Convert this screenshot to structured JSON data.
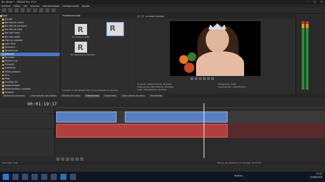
{
  "window": {
    "title": "Sin titulo * - VEGAS Pro 15.0"
  },
  "menu": [
    "Archivo",
    "Editar",
    "Ver",
    "Insertar",
    "Herramientas",
    "Configuración",
    "Ayuda"
  ],
  "explorer": {
    "root": "Todo",
    "items": [
      "Ajustar",
      "Barrido de cierre",
      "Barrido de persiana",
      "Barrido de reloj",
      "Barrido lineal",
      "Barrido radial",
      "Caja de pépelet",
      "Caja flash",
      "Desvane...",
      "Desvanecer",
      "Deslizar",
      "Esconde",
      "Efecto cruz",
      "Empujar",
      "Explosión",
      "Filtros pedazo",
      "Giro",
      "Hoja",
      "Fundido 3D",
      "Portamientos",
      "Portamientos cruzados",
      "Portales",
      "Puerta de galaxia"
    ]
  },
  "presets": {
    "title": "Predeterminado",
    "items": [
      "De arriba a abajo",
      "",
      "De izquierda a derecha",
      ""
    ],
    "info": "Cerrado en 3D VEGAS 180° Fundir Rotante de la bisel"
  },
  "preview": {
    "toolbar": [
      "Lo mejor (media)"
    ],
    "info_left": "Proyecto: 1080x720x32, 25,000p\nVista previa: 540x360x32, 25,000p\nVista: 540x360x32, 29,970p",
    "info_right": "Fotograma: 2.887\nVisualización: 540x360x32"
  },
  "tabs": [
    "Medios de proyecto",
    "Generadores de medios",
    "Efectos de video",
    "Transiciones",
    "Explorador",
    "Vista previa de video",
    "Recortador"
  ],
  "timeline": {
    "timecode": "00:01:19:17"
  },
  "status": {
    "text": "Velocidad: 0,00",
    "tiempo": "Tiempo de grabación (2 canales): 20:31:55"
  },
  "taskbar": {
    "weather": "Nieblas",
    "time": "13:37",
    "date": "23/06/2018"
  }
}
